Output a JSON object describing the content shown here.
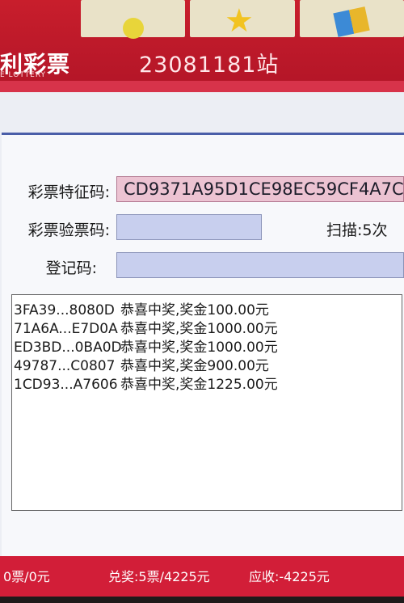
{
  "header": {
    "brand_main": "利彩票",
    "brand_sub": "E LOTTERY",
    "station": "23081181站"
  },
  "form": {
    "feature_code_label": "彩票特征码:",
    "feature_code_value": "CD9371A95D1CE98EC59CF4A7C",
    "verify_code_label": "彩票验票码:",
    "verify_code_value": "",
    "scan_text": "扫描:5次",
    "register_label": "登记码:",
    "register_value": ""
  },
  "results": [
    {
      "id": "3FA39...8080D",
      "msg": "恭喜中奖,奖金100.00元"
    },
    {
      "id": "71A6A...E7D0A",
      "msg": "恭喜中奖,奖金1000.00元"
    },
    {
      "id": "ED3BD...0BA0D",
      "msg": "恭喜中奖,奖金1000.00元"
    },
    {
      "id": "49787...C0807",
      "msg": "恭喜中奖,奖金900.00元"
    },
    {
      "id": "1CD93...A7606",
      "msg": "恭喜中奖,奖金1225.00元"
    }
  ],
  "footer": {
    "sale": "0票/0元",
    "payout": "兑奖:5票/4225元",
    "receivable": "应收:-4225元"
  },
  "colors": {
    "header_red": "#c81e2c",
    "footer_red": "#d21e38",
    "field_blue": "#c8cfee",
    "field_pink": "#ecc3d2"
  }
}
